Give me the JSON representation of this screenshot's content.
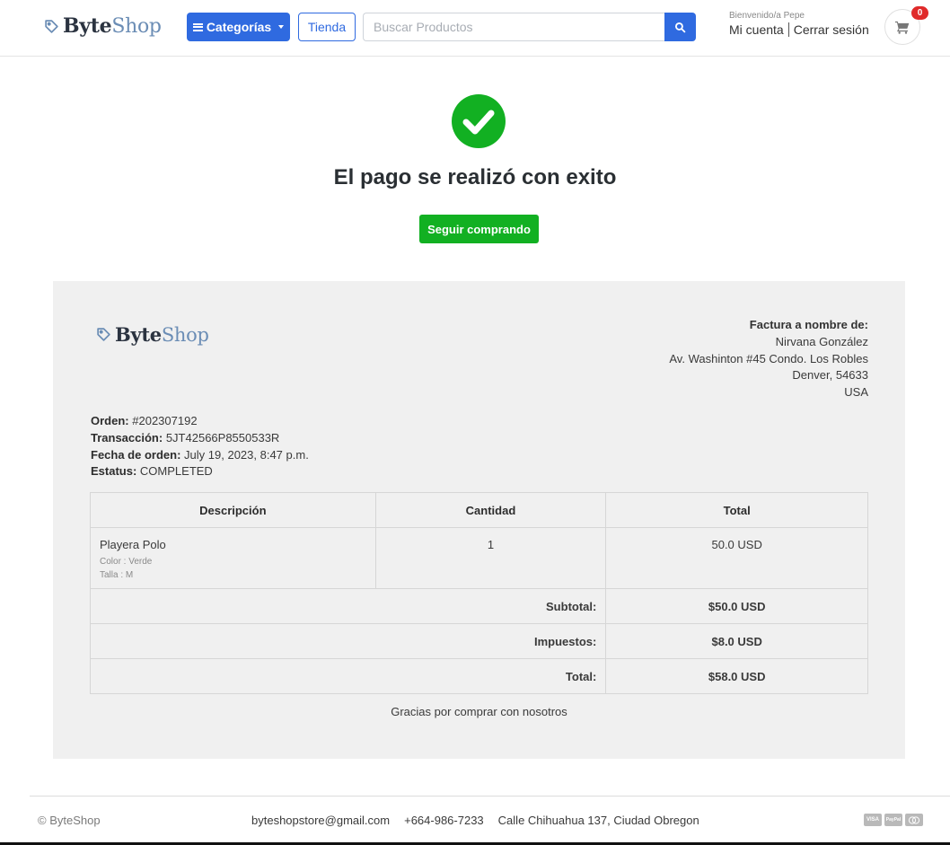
{
  "header": {
    "logo_bold": "Byte",
    "logo_light": "Shop",
    "categories_label": "Categorías",
    "store_label": "Tienda",
    "search_placeholder": "Buscar Productos",
    "welcome": "Bienvenido/a Pepe",
    "my_account": "Mi cuenta",
    "logout": "Cerrar sesión",
    "cart_count": "0"
  },
  "success": {
    "title": "El pago se realizó con exito",
    "continue_label": "Seguir comprando"
  },
  "invoice": {
    "logo_bold": "Byte",
    "logo_light": "Shop",
    "bill_to_label": "Factura a nombre de:",
    "bill_name": "Nirvana González",
    "bill_address": "Av. Washinton #45 Condo. Los Robles",
    "bill_city": "Denver, 54633",
    "bill_country": "USA",
    "order_label": "Orden:",
    "order_value": "#202307192",
    "transaction_label": "Transacción:",
    "transaction_value": "5JT42566P8550533R",
    "date_label": "Fecha de orden:",
    "date_value": "July 19, 2023, 8:47 p.m.",
    "status_label": "Estatus:",
    "status_value": "COMPLETED",
    "columns": [
      "Descripción",
      "Cantidad",
      "Total"
    ],
    "item": {
      "name": "Playera Polo",
      "color": "Color : Verde",
      "size": "Talla : M",
      "quantity": "1",
      "total": "50.0 USD"
    },
    "subtotal_label": "Subtotal:",
    "subtotal_value": "$50.0 USD",
    "tax_label": "Impuestos:",
    "tax_value": "$8.0 USD",
    "total_label": "Total:",
    "total_value": "$58.0 USD",
    "thanks": "Gracias por comprar con nosotros"
  },
  "footer": {
    "copyright": "© ByteShop",
    "email": "byteshopstore@gmail.com",
    "phone": "+664-986-7233",
    "address": "Calle Chihuahua 137, Ciudad Obregon",
    "payment_methods": [
      "VISA",
      "PayPal",
      "MC"
    ]
  },
  "colors": {
    "primary": "#2f6ae0",
    "success": "#12b022",
    "badge": "#e02a2a",
    "invoice_bg": "#f0f0f0"
  }
}
